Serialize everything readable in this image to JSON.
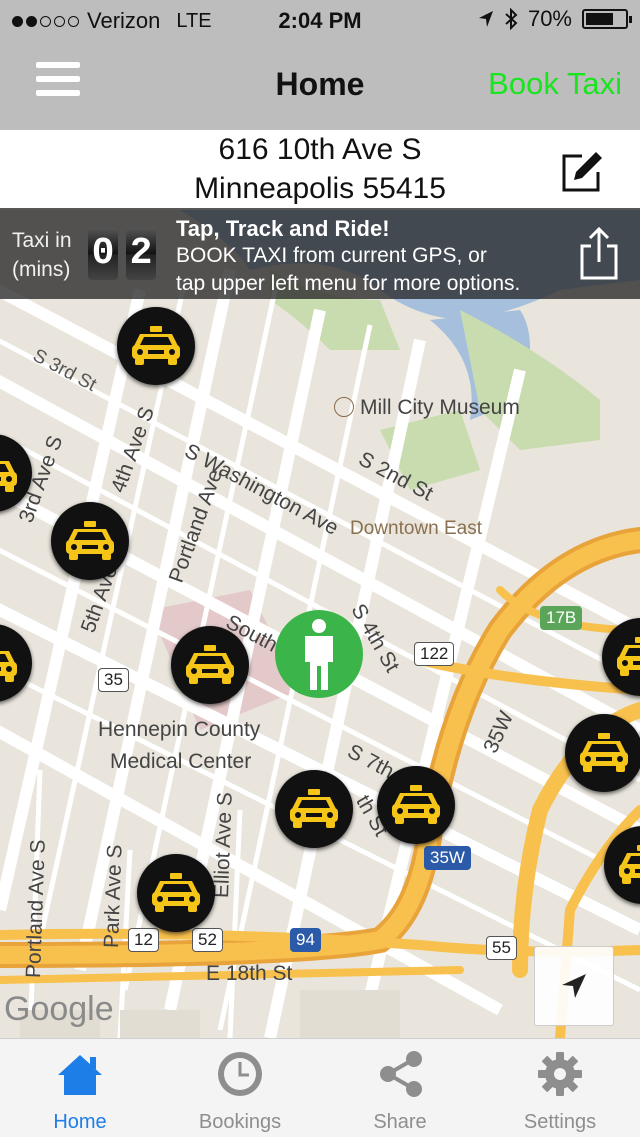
{
  "status": {
    "carrier": "Verizon",
    "network": "LTE",
    "time": "2:04 PM",
    "battery_percent": "70%",
    "battery_level": 0.7,
    "signal_bars": 2
  },
  "nav": {
    "title": "Home",
    "book_label": "Book Taxi",
    "book_color": "#19e51f"
  },
  "address": {
    "line1": "616 10th Ave S",
    "line2": "Minneapolis 55415"
  },
  "info": {
    "eta_label_line1": "Taxi in",
    "eta_label_line2": "(mins)",
    "eta_digit1": "0",
    "eta_digit2": "2",
    "title": "Tap, Track and Ride!",
    "line1": "BOOK TAXI from current GPS, or",
    "line2": "tap upper left menu for more options."
  },
  "map": {
    "labels": {
      "s3rd": "S 3rd St",
      "swash": "S Washington Ave",
      "s2nd": "S 2nd St",
      "mill": "Mill City Museum",
      "downtown": "Downtown East",
      "s4th": "S 4th St",
      "ave3": "3rd Ave S",
      "ave4": "4th Ave S",
      "ave5": "5th Ave S",
      "portland1": "Portland Ave",
      "south": "South",
      "hennepin1": "Hennepin County",
      "hennepin2": "Medical Center",
      "s7th": "S 7th",
      "th_st": "th St",
      "elliot": "Elliot Ave S",
      "park": "Park Ave S",
      "portland2": "Portland Ave S",
      "e18": "E 18th St",
      "i35w_label": "35W"
    },
    "shields": {
      "r122": "122",
      "r35": "35",
      "r17b": "17B",
      "r35w": "35W",
      "r12": "12",
      "r52": "52",
      "r94": "94",
      "r55": "55"
    },
    "google": "Google",
    "taxi_icon": "taxi-icon",
    "person_icon": "person-icon"
  },
  "tabs": [
    {
      "label": "Home",
      "icon": "home-icon"
    },
    {
      "label": "Bookings",
      "icon": "clock-icon"
    },
    {
      "label": "Share",
      "icon": "share-icon"
    },
    {
      "label": "Settings",
      "icon": "gear-icon"
    }
  ],
  "colors": {
    "active_tab": "#1e7ee8",
    "person_marker": "#3bb54a",
    "taxi_yellow": "#f5c518"
  }
}
